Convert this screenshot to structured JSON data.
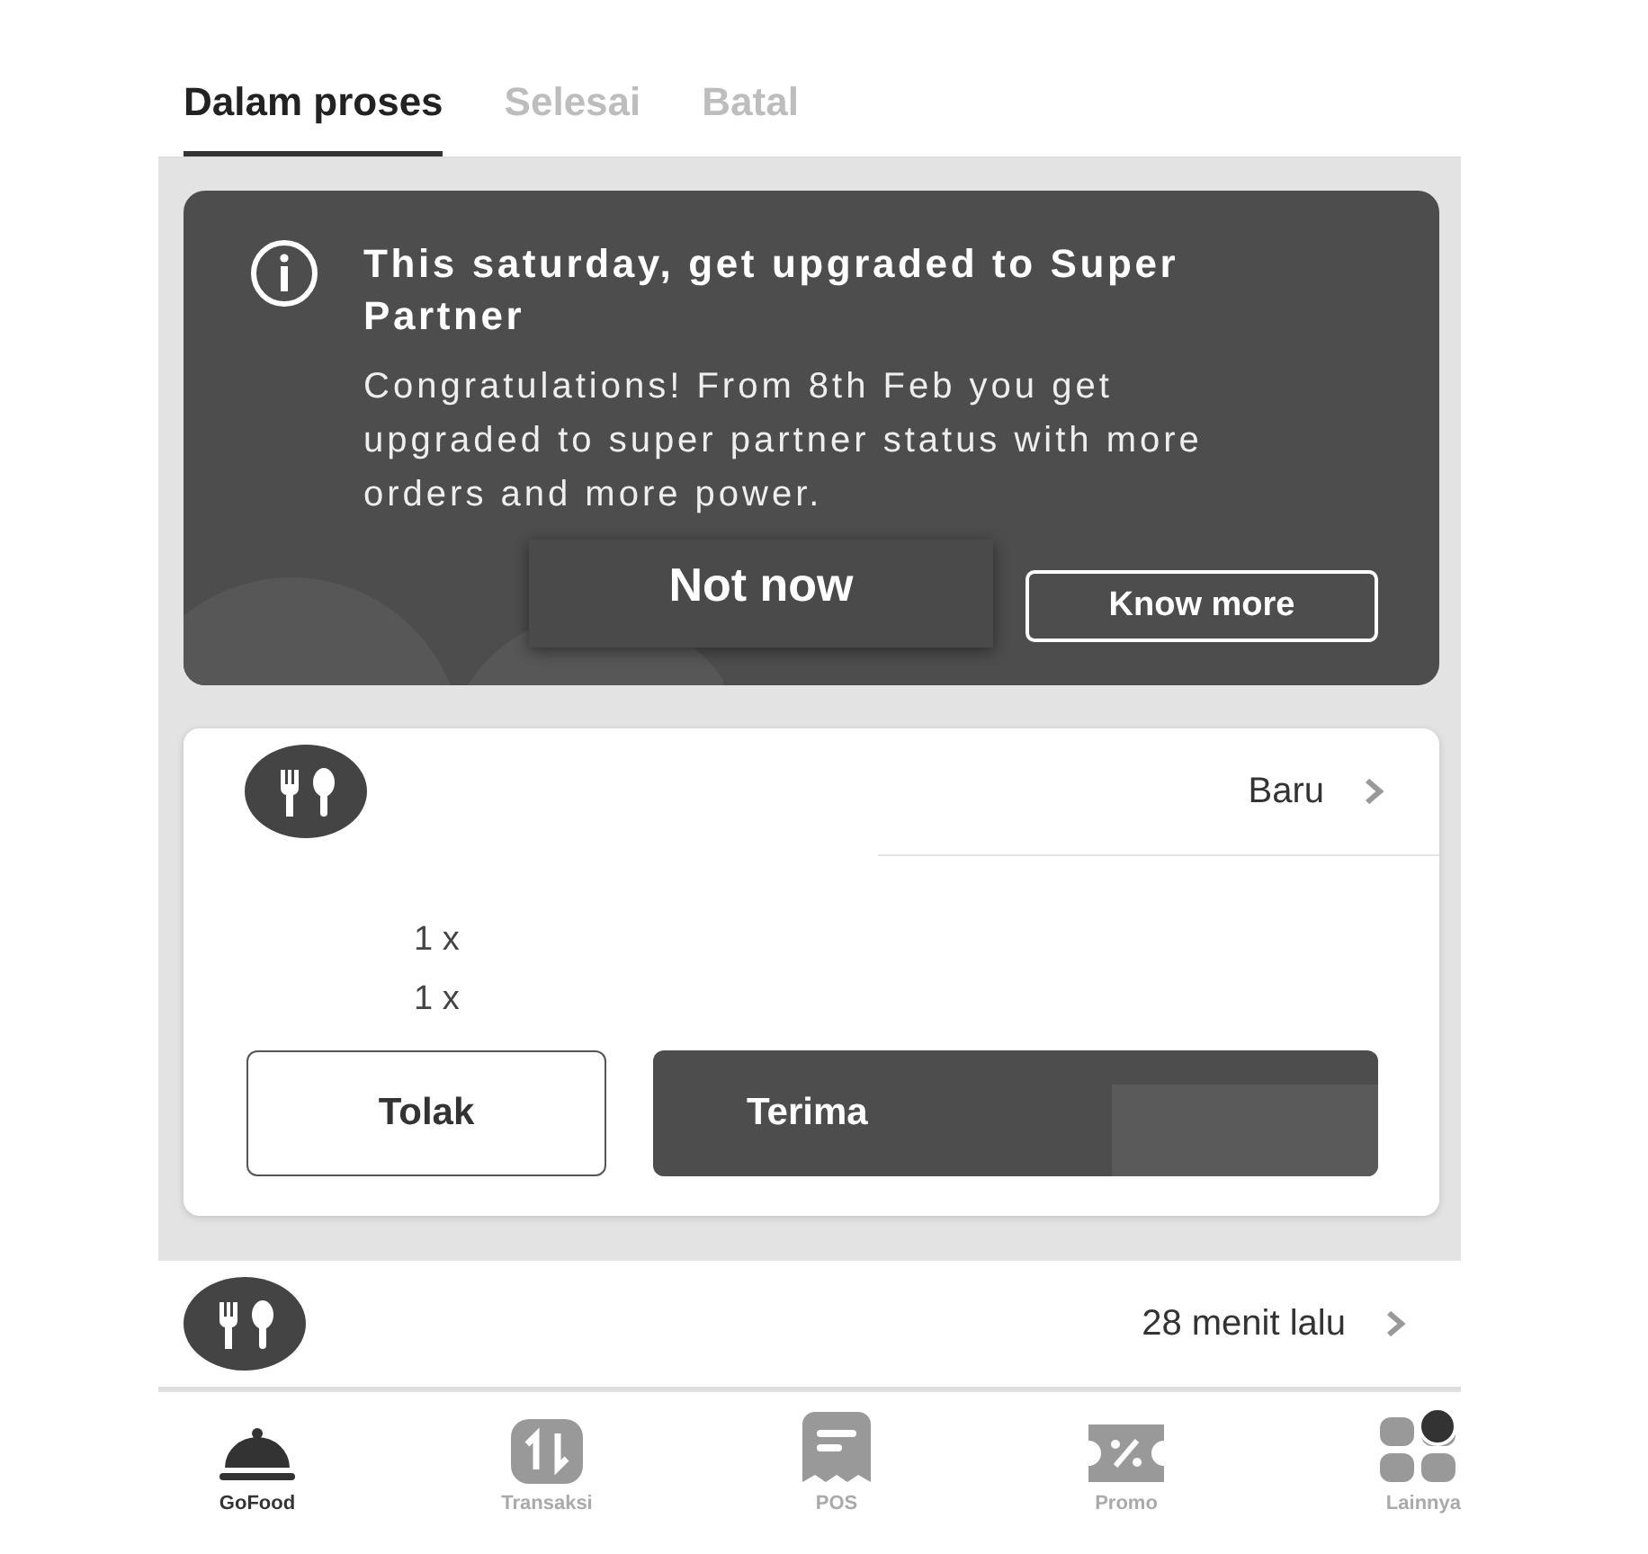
{
  "tabs": [
    {
      "label": "Dalam proses",
      "selected": true
    },
    {
      "label": "Selesai",
      "selected": false
    },
    {
      "label": "Batal",
      "selected": false
    }
  ],
  "banner": {
    "title": "This saturday, get upgraded to Super Partner",
    "message": "Congratulations! From 8th Feb you get upgraded to super partner status with more orders and more power.",
    "buttons": [
      {
        "label": "Not now",
        "kind": "raised"
      },
      {
        "label": "Know more",
        "kind": "outline"
      }
    ]
  },
  "orders": [
    {
      "status": "Baru",
      "items": [
        "1 x",
        "1 x"
      ],
      "actions": [
        {
          "label": "Tolak",
          "kind": "outline"
        },
        {
          "label": "Terima",
          "kind": "filled",
          "redacted": true
        }
      ]
    },
    {
      "status": "28 menit lalu"
    }
  ],
  "nav": [
    {
      "label": "GoFood",
      "selected": true,
      "notification": false
    },
    {
      "label": "Transaksi",
      "selected": false,
      "notification": false
    },
    {
      "label": "POS",
      "selected": false,
      "notification": false
    },
    {
      "label": "Promo",
      "selected": false,
      "notification": false
    },
    {
      "label": "Lainnya",
      "selected": false,
      "notification": true
    }
  ]
}
